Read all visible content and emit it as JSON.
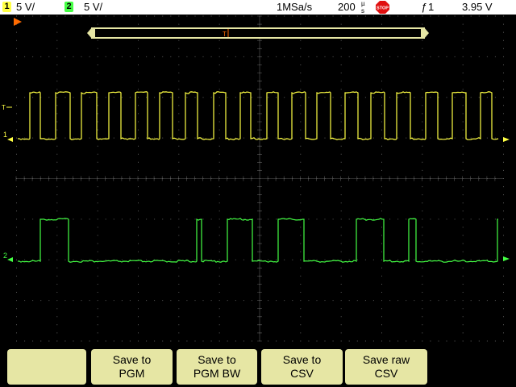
{
  "status_bar": {
    "ch1": {
      "badge": "1",
      "scale": "5 V/",
      "color": "#ffff44"
    },
    "ch2": {
      "badge": "2",
      "scale": "5 V/",
      "color": "#44ff44"
    },
    "sample_rate": "1MSa/s",
    "timebase_value": "200",
    "timebase_unit_top": "µ",
    "timebase_unit_bottom": "s",
    "run_state_icon": "stop-icon",
    "run_state_label": "STOP",
    "trigger_slope": "ƒ",
    "trigger_channel": "1",
    "trigger_level": "3.95 V"
  },
  "screen": {
    "trigger_label": "T",
    "ch1_marker": "1",
    "ch2_marker": "2",
    "trigger_level_marker": "T",
    "trace_colors": {
      "ch1": "#ffff44",
      "ch2": "#44ff44",
      "grid": "#5a5a5a",
      "accent": "#ff6a00"
    }
  },
  "softkeys": [
    {
      "line1": "",
      "line2": ""
    },
    {
      "line1": "Save to",
      "line2": "PGM"
    },
    {
      "line1": "Save to",
      "line2": "PGM BW"
    },
    {
      "line1": "Save to",
      "line2": "CSV"
    },
    {
      "line1": "Save raw",
      "line2": "CSV"
    }
  ]
}
